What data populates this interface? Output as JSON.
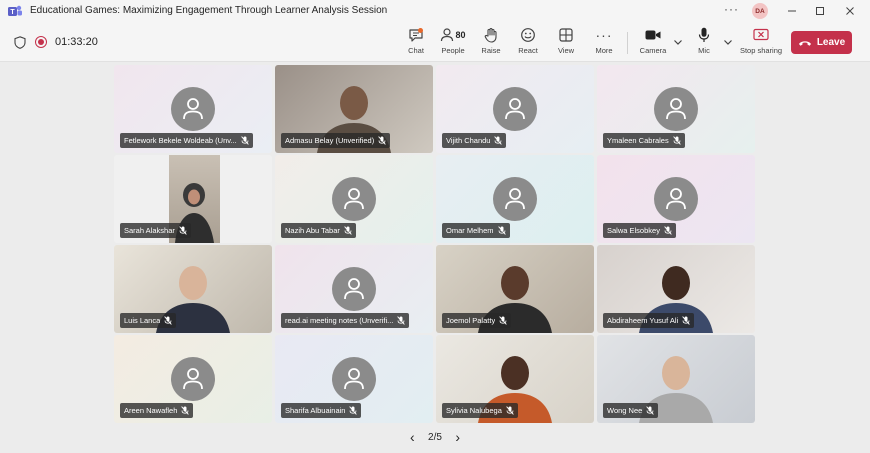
{
  "window": {
    "title": "Educational Games: Maximizing Engagement Through Learner Analysis Session",
    "avatar_initials": "DA",
    "more_label": "···"
  },
  "toolbar": {
    "timer": "01:33:20",
    "chat_label": "Chat",
    "people_label": "People",
    "people_count": "80",
    "raise_label": "Raise",
    "react_label": "React",
    "view_label": "View",
    "more_label": "More",
    "more_glyph": "···",
    "camera_label": "Camera",
    "mic_label": "Mic",
    "share_label": "Stop sharing",
    "leave_label": "Leave"
  },
  "participants": [
    {
      "name": "Fetlework Bekele Woldeab (Unv...",
      "kind": "avatar"
    },
    {
      "name": "Admasu Belay (Unverified)",
      "kind": "video"
    },
    {
      "name": "Vijith Chandu",
      "kind": "avatar"
    },
    {
      "name": "Ymaleen Cabrales",
      "kind": "avatar"
    },
    {
      "name": "Sarah Alakshar",
      "kind": "video"
    },
    {
      "name": "Nazih Abu Tabar",
      "kind": "avatar"
    },
    {
      "name": "Omar Melhem",
      "kind": "avatar"
    },
    {
      "name": "Salwa Elsobkey",
      "kind": "avatar"
    },
    {
      "name": "Luis Lanca",
      "kind": "video"
    },
    {
      "name": "read.ai meeting notes (Unverifi...",
      "kind": "avatar"
    },
    {
      "name": "Joemol Palatty",
      "kind": "video"
    },
    {
      "name": "Abdiraheem Yusuf Ali",
      "kind": "video"
    },
    {
      "name": "Areen Nawafleh",
      "kind": "avatar"
    },
    {
      "name": "Sharifa Albuainain",
      "kind": "avatar"
    },
    {
      "name": "Sylivia Nalubega",
      "kind": "video"
    },
    {
      "name": "Wong Nee",
      "kind": "video"
    }
  ],
  "pager": {
    "label": "2/5",
    "prev_glyph": "‹",
    "next_glyph": "›"
  },
  "colors": {
    "leave": "#c4314b",
    "avatar_circle": "#8b8b8b",
    "recording": "#c4314b",
    "brand": "#5b5fc7"
  }
}
